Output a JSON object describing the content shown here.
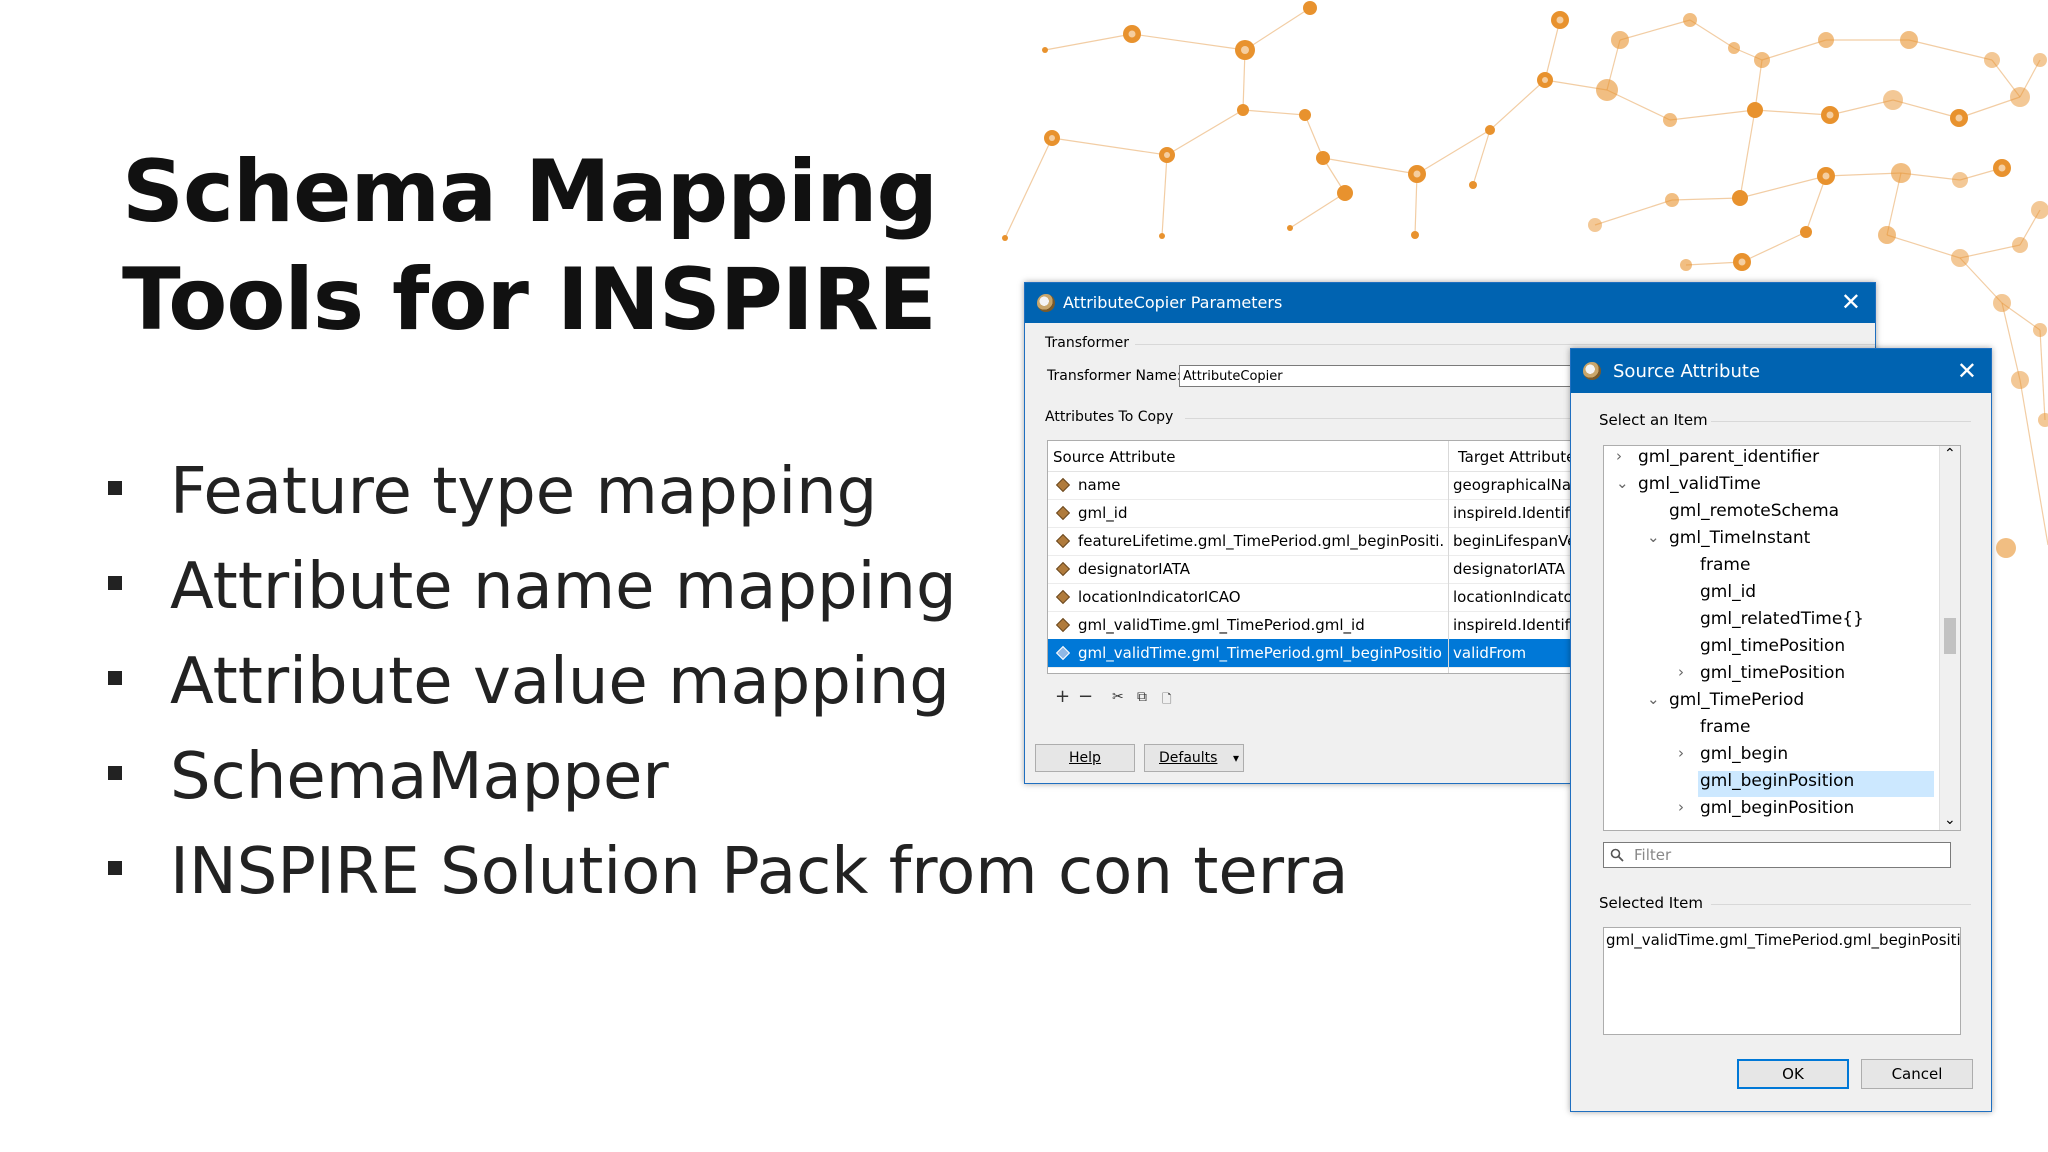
{
  "slide": {
    "title_line1": "Schema Mapping",
    "title_line2": "Tools for INSPIRE",
    "bullets": [
      "Feature type mapping",
      "Attribute name mapping",
      "Attribute value mapping",
      "SchemaMapper",
      "INSPIRE Solution Pack from con terra"
    ]
  },
  "colors": {
    "accent_orange": "#e8922e",
    "titlebar_blue": "#0063b1",
    "selection_blue": "#0078d7",
    "tree_selection": "#cce8ff"
  },
  "params_window": {
    "title": "AttributeCopier Parameters",
    "close_icon": "✕",
    "transformer_group": "Transformer",
    "transformer_name_label": "Transformer Name:",
    "transformer_name_value": "AttributeCopier",
    "attributes_group": "Attributes To Copy",
    "columns": [
      "Source Attribute",
      "Target Attribute"
    ],
    "rows": [
      {
        "source": "name",
        "target": "geographicalNa"
      },
      {
        "source": "gml_id",
        "target": "inspireId.Identifi"
      },
      {
        "source": "featureLifetime.gml_TimePeriod.gml_beginPositi...",
        "target": "beginLifespanVe"
      },
      {
        "source": "designatorIATA",
        "target": "designatorIATA"
      },
      {
        "source": "locationIndicatorICAO",
        "target": "locationIndicato"
      },
      {
        "source": "gml_validTime.gml_TimePeriod.gml_id",
        "target": "inspireId.Identifi"
      },
      {
        "source": "gml_validTime.gml_TimePeriod.gml_beginPosition",
        "target": "validFrom"
      }
    ],
    "tools": [
      "+",
      "−",
      "✂",
      "⧉",
      "🗋"
    ],
    "help_label": "Help",
    "defaults_label": "Defaults",
    "defaults_arrow": "▾"
  },
  "source_dialog": {
    "title": "Source Attribute",
    "close_icon": "✕",
    "select_label": "Select an Item",
    "tree": [
      {
        "label": "gml_parent_identifier",
        "arrow": "›"
      },
      {
        "label": "gml_validTime",
        "arrow": "⌄"
      },
      {
        "label": "gml_remoteSchema",
        "arrow": ""
      },
      {
        "label": "gml_TimeInstant",
        "arrow": "⌄"
      },
      {
        "label": "frame",
        "arrow": ""
      },
      {
        "label": "gml_id",
        "arrow": ""
      },
      {
        "label": "gml_relatedTime{}",
        "arrow": ""
      },
      {
        "label": "gml_timePosition",
        "arrow": ""
      },
      {
        "label": "gml_timePosition",
        "arrow": "›"
      },
      {
        "label": "gml_TimePeriod",
        "arrow": "⌄"
      },
      {
        "label": "frame",
        "arrow": ""
      },
      {
        "label": "gml_begin",
        "arrow": "›"
      },
      {
        "label": "gml_beginPosition",
        "arrow": ""
      },
      {
        "label": "gml_beginPosition",
        "arrow": "›"
      }
    ],
    "scroll_up": "⌃",
    "scroll_down": "⌄",
    "filter_placeholder": "Filter",
    "selected_label": "Selected Item",
    "selected_value": "gml_validTime.gml_TimePeriod.gml_beginPosition",
    "ok_label": "OK",
    "cancel_label": "Cancel"
  }
}
